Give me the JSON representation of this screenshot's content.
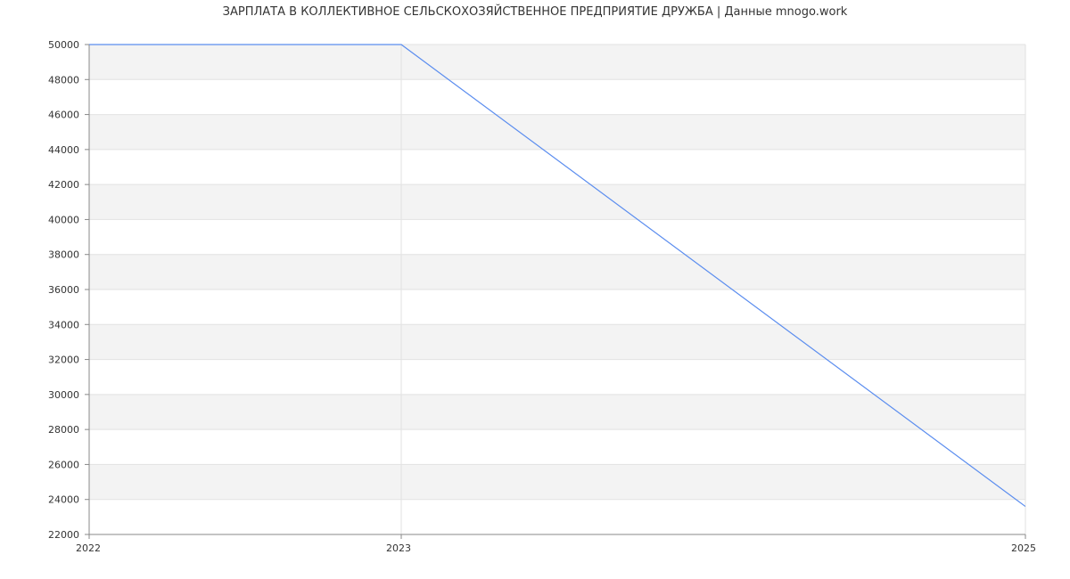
{
  "chart_data": {
    "type": "line",
    "title": "ЗАРПЛАТА В  КОЛЛЕКТИВНОЕ СЕЛЬСКОХОЗЯЙСТВЕННОЕ ПРЕДПРИЯТИЕ ДРУЖБА | Данные mnogo.work",
    "xlabel": "",
    "ylabel": "",
    "x": [
      "2022",
      "2023",
      "2025"
    ],
    "x_numeric": [
      2022,
      2023,
      2025
    ],
    "series": [
      {
        "values": [
          50000,
          50000,
          23600
        ]
      }
    ],
    "ylim": [
      22000,
      50000
    ],
    "yticks": [
      22000,
      24000,
      26000,
      28000,
      30000,
      32000,
      34000,
      36000,
      38000,
      40000,
      42000,
      44000,
      46000,
      48000,
      50000
    ],
    "grid": true,
    "legend": "none",
    "colors": {
      "line": "#5b8def",
      "band": "#f3f3f3",
      "grid": "#e2e2e2",
      "axis": "#888888"
    }
  }
}
